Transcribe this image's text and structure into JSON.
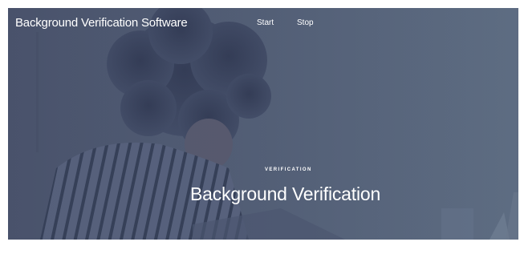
{
  "navbar": {
    "brand": "Background Verification Software",
    "links": [
      {
        "label": "Start"
      },
      {
        "label": "Stop"
      }
    ]
  },
  "hero": {
    "eyebrow": "VERIFICATION",
    "title": "Background Verification",
    "background_image": "person-with-curly-hair-striped-shirt-at-laptop",
    "overlay_color": "#525d74"
  }
}
